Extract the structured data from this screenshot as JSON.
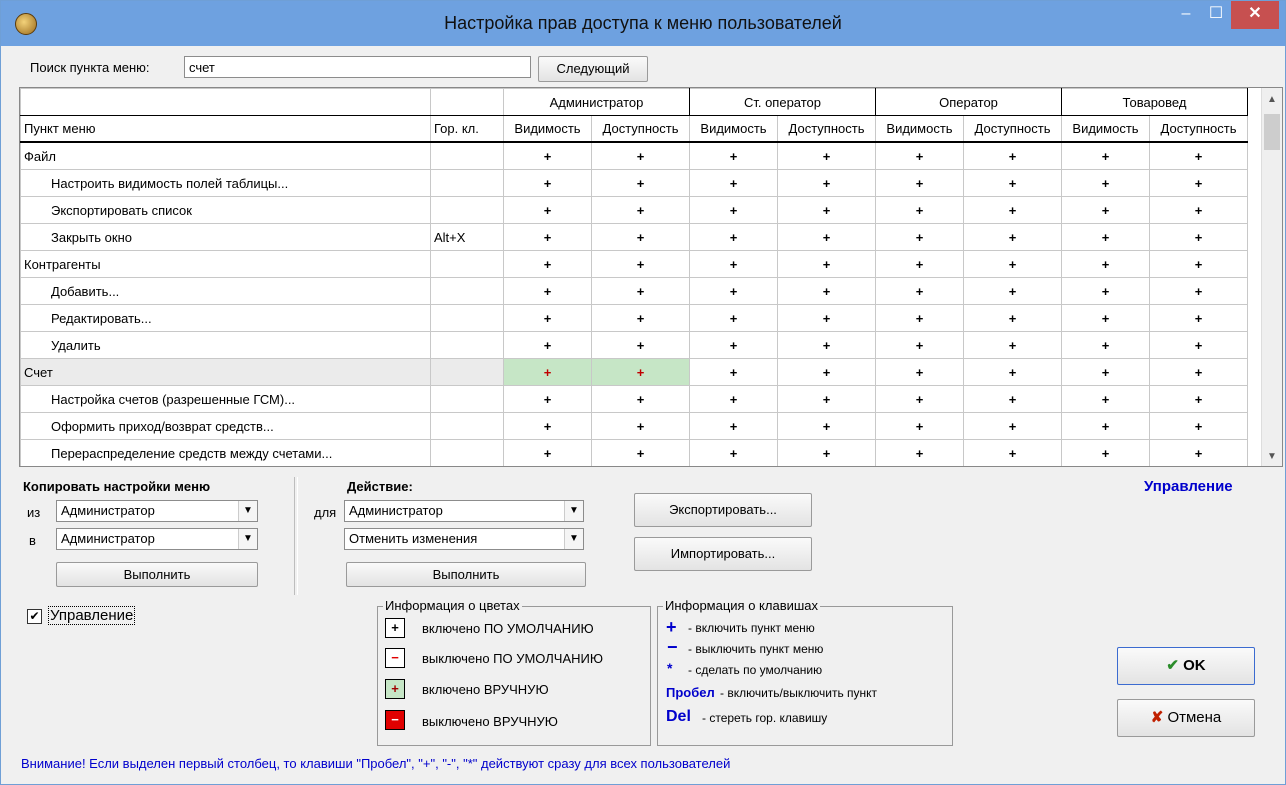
{
  "window": {
    "title": "Настройка прав доступа к меню пользователей",
    "min_glyph": "‒",
    "max_glyph": "☐",
    "close_glyph": "✕"
  },
  "search": {
    "label": "Поиск пункта меню:",
    "value": "счет",
    "next_button": "Следующий"
  },
  "grid": {
    "col_menu": "Пункт меню",
    "col_hotkey": "Гор. кл.",
    "sub_visibility": "Видимость",
    "sub_access": "Доступность",
    "roles": [
      "Администратор",
      "Ст. оператор",
      "Оператор",
      "Товаровед"
    ],
    "plus_glyph": "+",
    "rows": [
      {
        "label": "Файл",
        "indent": false,
        "hotkey": "",
        "selected": false,
        "manual": [
          false,
          false,
          false,
          false,
          false,
          false,
          false,
          false
        ]
      },
      {
        "label": "Настроить видимость полей таблицы...",
        "indent": true,
        "hotkey": "",
        "selected": false,
        "manual": [
          false,
          false,
          false,
          false,
          false,
          false,
          false,
          false
        ]
      },
      {
        "label": "Экспортировать список",
        "indent": true,
        "hotkey": "",
        "selected": false,
        "manual": [
          false,
          false,
          false,
          false,
          false,
          false,
          false,
          false
        ]
      },
      {
        "label": "Закрыть окно",
        "indent": true,
        "hotkey": "Alt+X",
        "selected": false,
        "manual": [
          false,
          false,
          false,
          false,
          false,
          false,
          false,
          false
        ]
      },
      {
        "label": "Контрагенты",
        "indent": false,
        "hotkey": "",
        "selected": false,
        "manual": [
          false,
          false,
          false,
          false,
          false,
          false,
          false,
          false
        ]
      },
      {
        "label": "Добавить...",
        "indent": true,
        "hotkey": "",
        "selected": false,
        "manual": [
          false,
          false,
          false,
          false,
          false,
          false,
          false,
          false
        ]
      },
      {
        "label": "Редактировать...",
        "indent": true,
        "hotkey": "",
        "selected": false,
        "manual": [
          false,
          false,
          false,
          false,
          false,
          false,
          false,
          false
        ]
      },
      {
        "label": "Удалить",
        "indent": true,
        "hotkey": "",
        "selected": false,
        "manual": [
          false,
          false,
          false,
          false,
          false,
          false,
          false,
          false
        ]
      },
      {
        "label": "Счет",
        "indent": false,
        "hotkey": "",
        "selected": true,
        "manual": [
          true,
          true,
          false,
          false,
          false,
          false,
          false,
          false
        ]
      },
      {
        "label": "Настройка счетов (разрешенные ГСМ)...",
        "indent": true,
        "hotkey": "",
        "selected": false,
        "manual": [
          false,
          false,
          false,
          false,
          false,
          false,
          false,
          false
        ]
      },
      {
        "label": "Оформить приход/возврат средств...",
        "indent": true,
        "hotkey": "",
        "selected": false,
        "manual": [
          false,
          false,
          false,
          false,
          false,
          false,
          false,
          false
        ]
      },
      {
        "label": "Перераспределение средств между счетами...",
        "indent": true,
        "hotkey": "",
        "selected": false,
        "manual": [
          false,
          false,
          false,
          false,
          false,
          false,
          false,
          false
        ]
      }
    ]
  },
  "copy": {
    "title": "Копировать настройки меню",
    "from_label": "из",
    "from_value": "Администратор",
    "to_label": "в",
    "to_value": "Администратор",
    "run": "Выполнить"
  },
  "action": {
    "title": "Действие:",
    "for_label": "для",
    "for_value": "Администратор",
    "action_value": "Отменить изменения",
    "run": "Выполнить"
  },
  "export_button": "Экспортировать...",
  "import_button": "Импортировать...",
  "control_heading": "Управление",
  "control_checkbox": {
    "label": "Управление",
    "checked": true,
    "mark": "✔"
  },
  "colors_info": {
    "title": "Информация о цветах",
    "items": [
      {
        "symbol": "+",
        "text": "включено ПО УМОЛЧАНИЮ"
      },
      {
        "symbol": "−",
        "text": "выключено ПО УМОЛЧАНИЮ"
      },
      {
        "symbol": "+",
        "text": "включено ВРУЧНУЮ"
      },
      {
        "symbol": "−",
        "text": "выключено ВРУЧНУЮ"
      }
    ]
  },
  "keys_info": {
    "title": "Информация о клавишах",
    "items": [
      {
        "key": "+",
        "text": "- включить пункт меню"
      },
      {
        "key": "−",
        "text": "- выключить пункт меню"
      },
      {
        "key": "*",
        "text": "- сделать по умолчанию"
      },
      {
        "key": "Пробел",
        "text": "- включить/выключить пункт"
      },
      {
        "key": "Del",
        "text": "- стереть гор. клавишу"
      }
    ]
  },
  "ok_button": {
    "label": "OK",
    "icon": "✔"
  },
  "cancel_button": {
    "label": "Отмена",
    "icon": "✘"
  },
  "footer_note": "Внимание! Если выделен первый столбец, то клавиши \"Пробел\", \"+\", \"-\", \"*\" действуют сразу для всех пользователей",
  "colors": {
    "accent_blue": "#0000cc",
    "manual_green": "#c6e6c6",
    "titlebar": "#6ea1e0",
    "close_red": "#c75050"
  }
}
